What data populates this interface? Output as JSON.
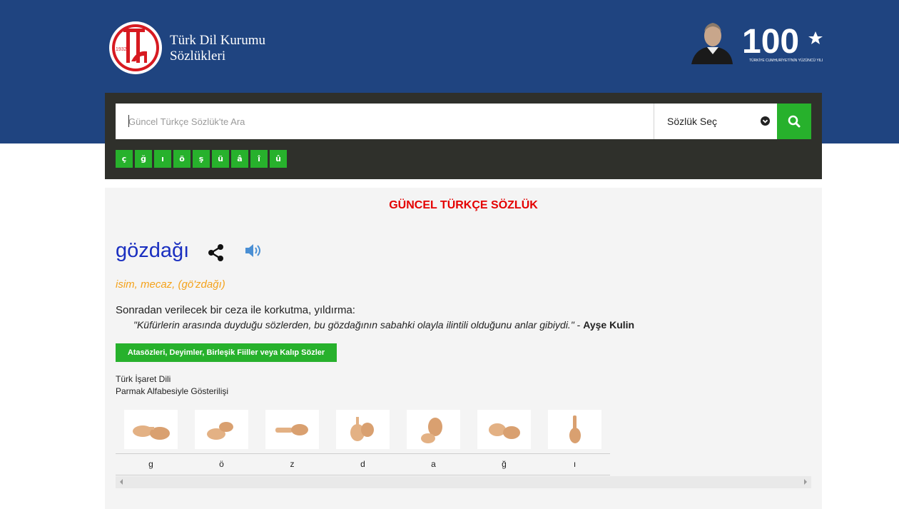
{
  "header": {
    "brand_line1": "Türk Dil Kurumu",
    "brand_line2": "Sözlükleri",
    "logo_year": "1932",
    "centennial_number": "100",
    "centennial_caption": "TÜRKİYE CUMHURİYETİ'NİN YÜZÜNCÜ YILI",
    "brand_color": "#1f4480"
  },
  "search": {
    "placeholder": "Güncel Türkçe Sözlük'te Ara",
    "value": "",
    "dictionary_select_label": "Sözlük Seç",
    "button_icon": "search-icon",
    "special_chars": [
      "ç",
      "ğ",
      "ı",
      "ö",
      "ş",
      "ü",
      "â",
      "î",
      "û"
    ],
    "accent_color": "#27b12c"
  },
  "entry": {
    "dictionary_title": "GÜNCEL TÜRKÇE SÖZLÜK",
    "word": "gözdağı",
    "share_icon": "share-icon",
    "audio_icon": "speaker-icon",
    "grammar": "isim, mecaz, (gö'zdağı)",
    "definition": "Sonradan verilecek bir ceza ile korkutma, yıldırma:",
    "example_quote": "\"Küfürlerin arasında duyduğu sözlerden, bu gözdağının sabahki olayla ilintili olduğunu anlar gibiydi.\"",
    "example_dash": " - ",
    "example_author": "Ayşe Kulin",
    "idioms_button": "Atasözleri, Deyimler, Birleşik Fiiller veya Kalıp Sözler"
  },
  "sign_language": {
    "title": "Türk İşaret Dili",
    "subtitle": "Parmak Alfabesiyle Gösterilişi",
    "letters": [
      "g",
      "ö",
      "z",
      "d",
      "a",
      "ğ",
      "ı"
    ]
  }
}
